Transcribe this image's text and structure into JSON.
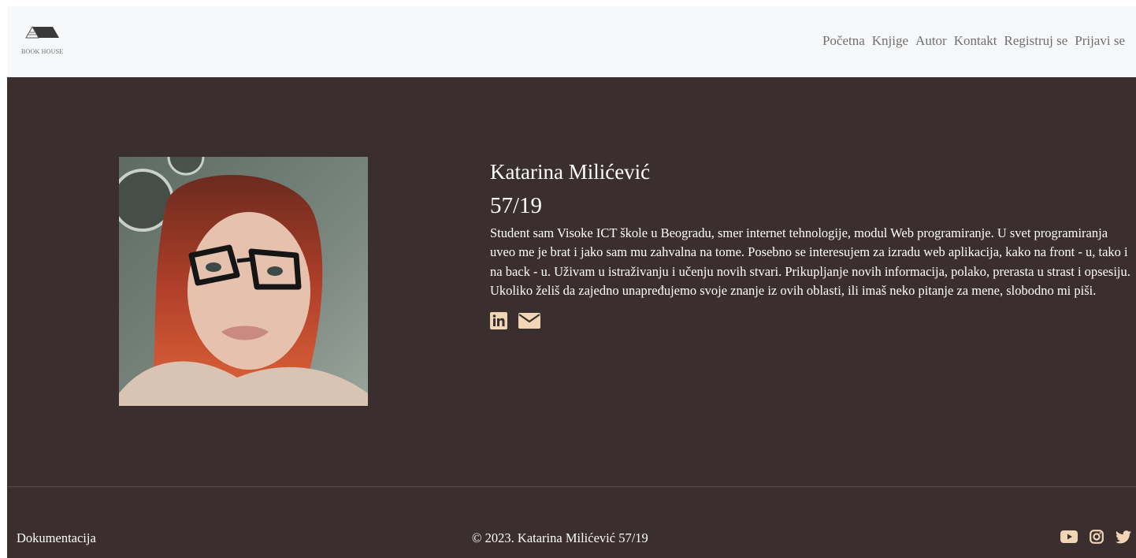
{
  "brand": {
    "logo_text": "BOOK HOUSE",
    "logo_icon": "book-house-logo"
  },
  "nav": {
    "items": [
      {
        "label": "Početna"
      },
      {
        "label": "Knjige"
      },
      {
        "label": "Autor"
      },
      {
        "label": "Kontakt"
      },
      {
        "label": "Registruj se"
      },
      {
        "label": "Prijavi se"
      }
    ]
  },
  "author": {
    "name": "Katarina Milićević",
    "index": "57/19",
    "bio": "Student sam Visoke ICT škole u Beogradu, smer internet tehnologije, modul Web programiranje. U svet programiranja uveo me je brat i jako sam mu zahvalna na tome. Posebno se interesujem za izradu web aplikacija, kako na front - u, tako i na back - u. Uživam u istraživanju i učenju novih stvari. Prikupljanje novih informacija, polako, prerasta u strast i opsesiju. Ukoliko želiš da zajedno unapređujemo svoje znanje iz ovih oblasti, ili imaš neko pitanje za mene, slobodno mi piši.",
    "social_icons": [
      "linkedin-icon",
      "envelope-icon"
    ]
  },
  "footer": {
    "doc_link": "Dokumentacija",
    "copyright": "© 2023. Katarina Milićević 57/19",
    "icons": [
      "youtube-icon",
      "instagram-icon",
      "twitter-icon"
    ]
  },
  "colors": {
    "background": "#3b2e2f",
    "navbar": "#f7f8f9",
    "icon_accent": "#f0d6b4",
    "nav_text": "#6f6f6f"
  }
}
